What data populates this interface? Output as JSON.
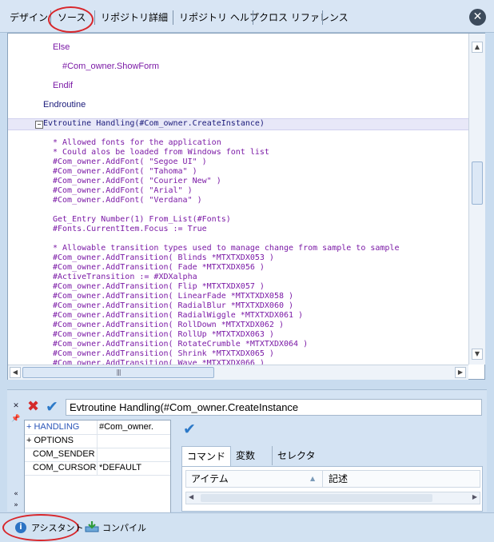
{
  "tabs": [
    "デザイン",
    "ソース",
    "リポジトリ詳細",
    "リポジトリ ヘルプ",
    "クロス リファレンス"
  ],
  "code_lines": [
    {
      "text": "Else",
      "cls": "sans"
    },
    {
      "text": "#Com_owner.ShowForm",
      "cls": "sans"
    },
    {
      "text": "Endif",
      "cls": "sans"
    },
    {
      "text": "Endroutine",
      "cls": "sans black"
    },
    {
      "text": "Evtroutine Handling(#Com_owner.CreateInstance)",
      "cls": "black"
    },
    {
      "text": "* Allowed fonts for the application",
      "cls": ""
    },
    {
      "text": "* Could alos be loaded from Windows font list",
      "cls": ""
    },
    {
      "text": "#Com_owner.AddFont( \"Segoe UI\" )",
      "cls": ""
    },
    {
      "text": "#Com_owner.AddFont( \"Tahoma\" )",
      "cls": ""
    },
    {
      "text": "#Com_owner.AddFont( \"Courier New\" )",
      "cls": ""
    },
    {
      "text": "#Com_owner.AddFont( \"Arial\" )",
      "cls": ""
    },
    {
      "text": "#Com_owner.AddFont( \"Verdana\" )",
      "cls": ""
    },
    {
      "text": "Get_Entry Number(1) From_List(#Fonts)",
      "cls": ""
    },
    {
      "text": "#Fonts.CurrentItem.Focus := True",
      "cls": ""
    },
    {
      "text": "* Allowable transition types used to manage change from sample to sample",
      "cls": ""
    },
    {
      "text": "#Com_owner.AddTransition( Blinds *MTXTXDX053 )",
      "cls": ""
    },
    {
      "text": "#Com_owner.AddTransition( Fade *MTXTXDX056 )",
      "cls": ""
    },
    {
      "text": "#ActiveTransition := #XDXalpha",
      "cls": ""
    },
    {
      "text": "#Com_owner.AddTransition( Flip *MTXTXDX057 )",
      "cls": ""
    },
    {
      "text": "#Com_owner.AddTransition( LinearFade *MTXTXDX058 )",
      "cls": ""
    },
    {
      "text": "#Com_owner.AddTransition( RadialBlur *MTXTXDX060 )",
      "cls": ""
    },
    {
      "text": "#Com_owner.AddTransition( RadialWiggle *MTXTXDX061 )",
      "cls": ""
    },
    {
      "text": "#Com_owner.AddTransition( RollDown *MTXTXDX062 )",
      "cls": ""
    },
    {
      "text": "#Com_owner.AddTransition( RollUp *MTXTXDX063 )",
      "cls": ""
    },
    {
      "text": "#Com_owner.AddTransition( RotateCrumble *MTXTXDX064 )",
      "cls": ""
    },
    {
      "text": "#Com_owner.AddTransition( Shrink *MTXTXDX065 )",
      "cls": ""
    },
    {
      "text": "#Com_owner.AddTransition( Wave *MTXTXDX066 )",
      "cls": ""
    }
  ],
  "command_input": "Evtroutine Handling(#Com_owner.CreateInstance",
  "params": [
    {
      "name": "+ HANDLING",
      "value": "#Com_owner.",
      "active": true
    },
    {
      "name": "+ OPTIONS",
      "value": ""
    },
    {
      "name": "COM_SENDER",
      "value": ""
    },
    {
      "name": "COM_CURSOR",
      "value": "*DEFAULT"
    }
  ],
  "subtabs": [
    "コマンド",
    "変数",
    "セレクタ"
  ],
  "grid_headers": [
    "アイテム",
    "記述"
  ],
  "bottom": {
    "assistant": "アシスタント",
    "compile": "コンパイル"
  },
  "colors": {
    "code": "#7b1aa6",
    "keyword": "#1a1a7a",
    "accent": "#2c79c8",
    "highlight_ring": "#d8262b"
  }
}
